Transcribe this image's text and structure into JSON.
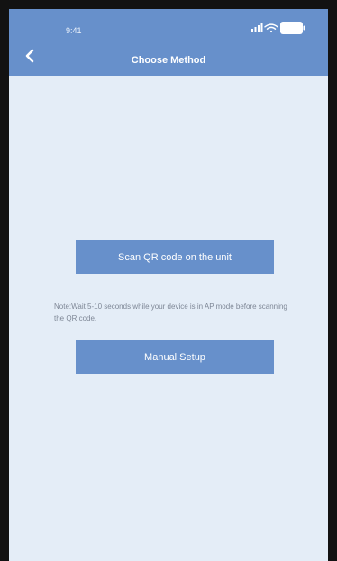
{
  "status_bar": {
    "time": "9:41",
    "icons": [
      "signal-icon",
      "wifi-icon",
      "battery-icon"
    ]
  },
  "header": {
    "title": "Choose Method",
    "back_icon": "chevron-left-icon"
  },
  "main": {
    "scan_button_label": "Scan QR code on the unit",
    "note": "Note:Wait 5-10 seconds while your device is in AP mode before scanning the QR code.",
    "manual_button_label": "Manual Setup"
  },
  "colors": {
    "header_background": "#6790cb",
    "page_background": "#e4edf7",
    "button_background": "#6790cb",
    "note_text": "#7e8796",
    "device_frame": "#121212"
  }
}
